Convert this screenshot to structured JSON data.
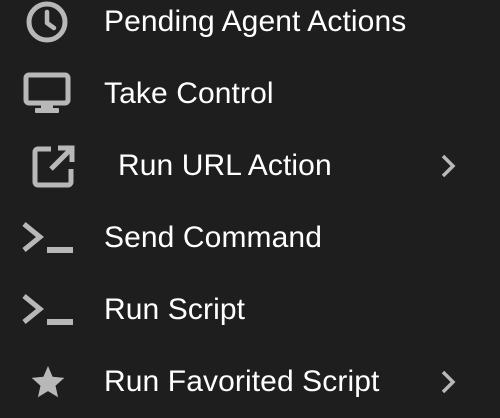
{
  "menu": {
    "items": [
      {
        "label": "Pending Agent Actions",
        "icon": "clock-icon",
        "has_submenu": false
      },
      {
        "label": "Take Control",
        "icon": "monitor-icon",
        "has_submenu": false
      },
      {
        "label": "Run URL Action",
        "icon": "open-in-new-icon",
        "has_submenu": true
      },
      {
        "label": "Send Command",
        "icon": "terminal-icon",
        "has_submenu": false
      },
      {
        "label": "Run Script",
        "icon": "terminal-icon",
        "has_submenu": false
      },
      {
        "label": "Run Favorited Script",
        "icon": "star-icon",
        "has_submenu": true
      }
    ]
  },
  "colors": {
    "background": "#1e1e1e",
    "text": "#ffffff",
    "icon": "#b8b8b8"
  }
}
